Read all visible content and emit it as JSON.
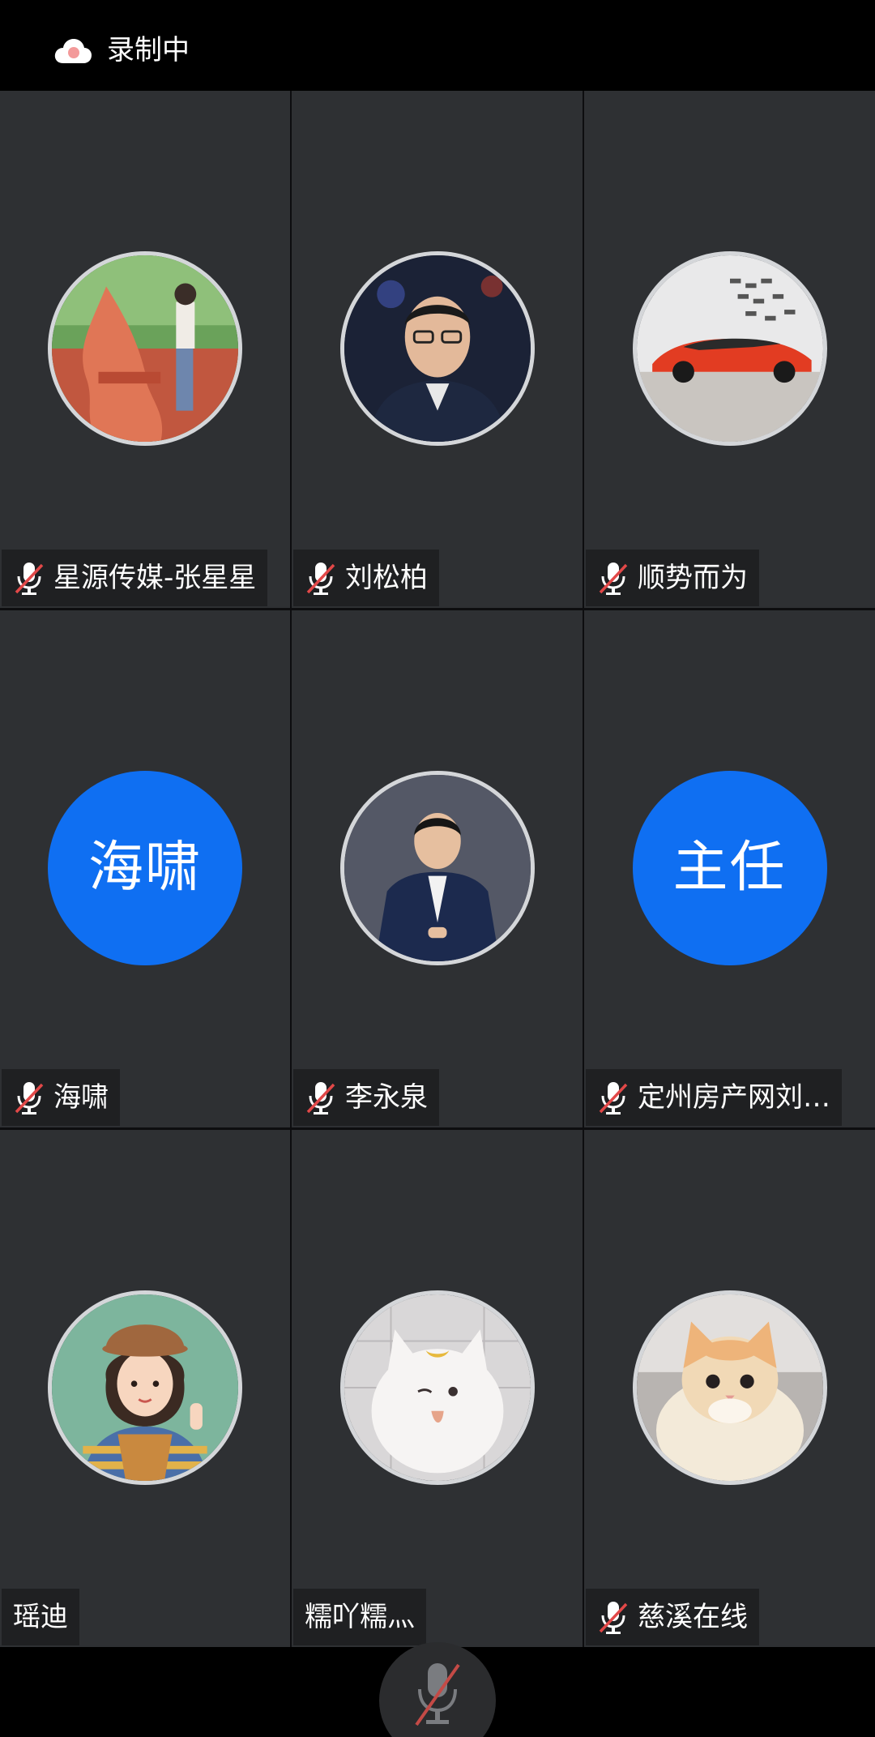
{
  "status": {
    "recording_icon": "cloud-recording-icon",
    "recording_label": "录制中",
    "recording_color": "#f7a8a8"
  },
  "participants": [
    {
      "name": "星源传媒-张星星",
      "muted": true,
      "avatar": "photo"
    },
    {
      "name": "刘松柏",
      "muted": true,
      "avatar": "photo"
    },
    {
      "name": "顺势而为",
      "muted": true,
      "avatar": "photo"
    },
    {
      "name": "海啸",
      "muted": true,
      "avatar_text": "海啸"
    },
    {
      "name": "李永泉",
      "muted": true,
      "avatar": "photo"
    },
    {
      "name": "定州房产网刘…",
      "muted": true,
      "avatar_text": "主任"
    },
    {
      "name": "瑶迪",
      "muted": false,
      "avatar": "photo"
    },
    {
      "name": "糯吖糯灬",
      "muted": false,
      "avatar": "photo"
    },
    {
      "name": "慈溪在线",
      "muted": true,
      "avatar": "photo"
    }
  ],
  "controls": {
    "mic_icon": "mic-off-icon"
  },
  "colors": {
    "tile_bg": "#2e3033",
    "avatar_blue": "#0f6ff2",
    "mute_slash": "#e24848"
  }
}
